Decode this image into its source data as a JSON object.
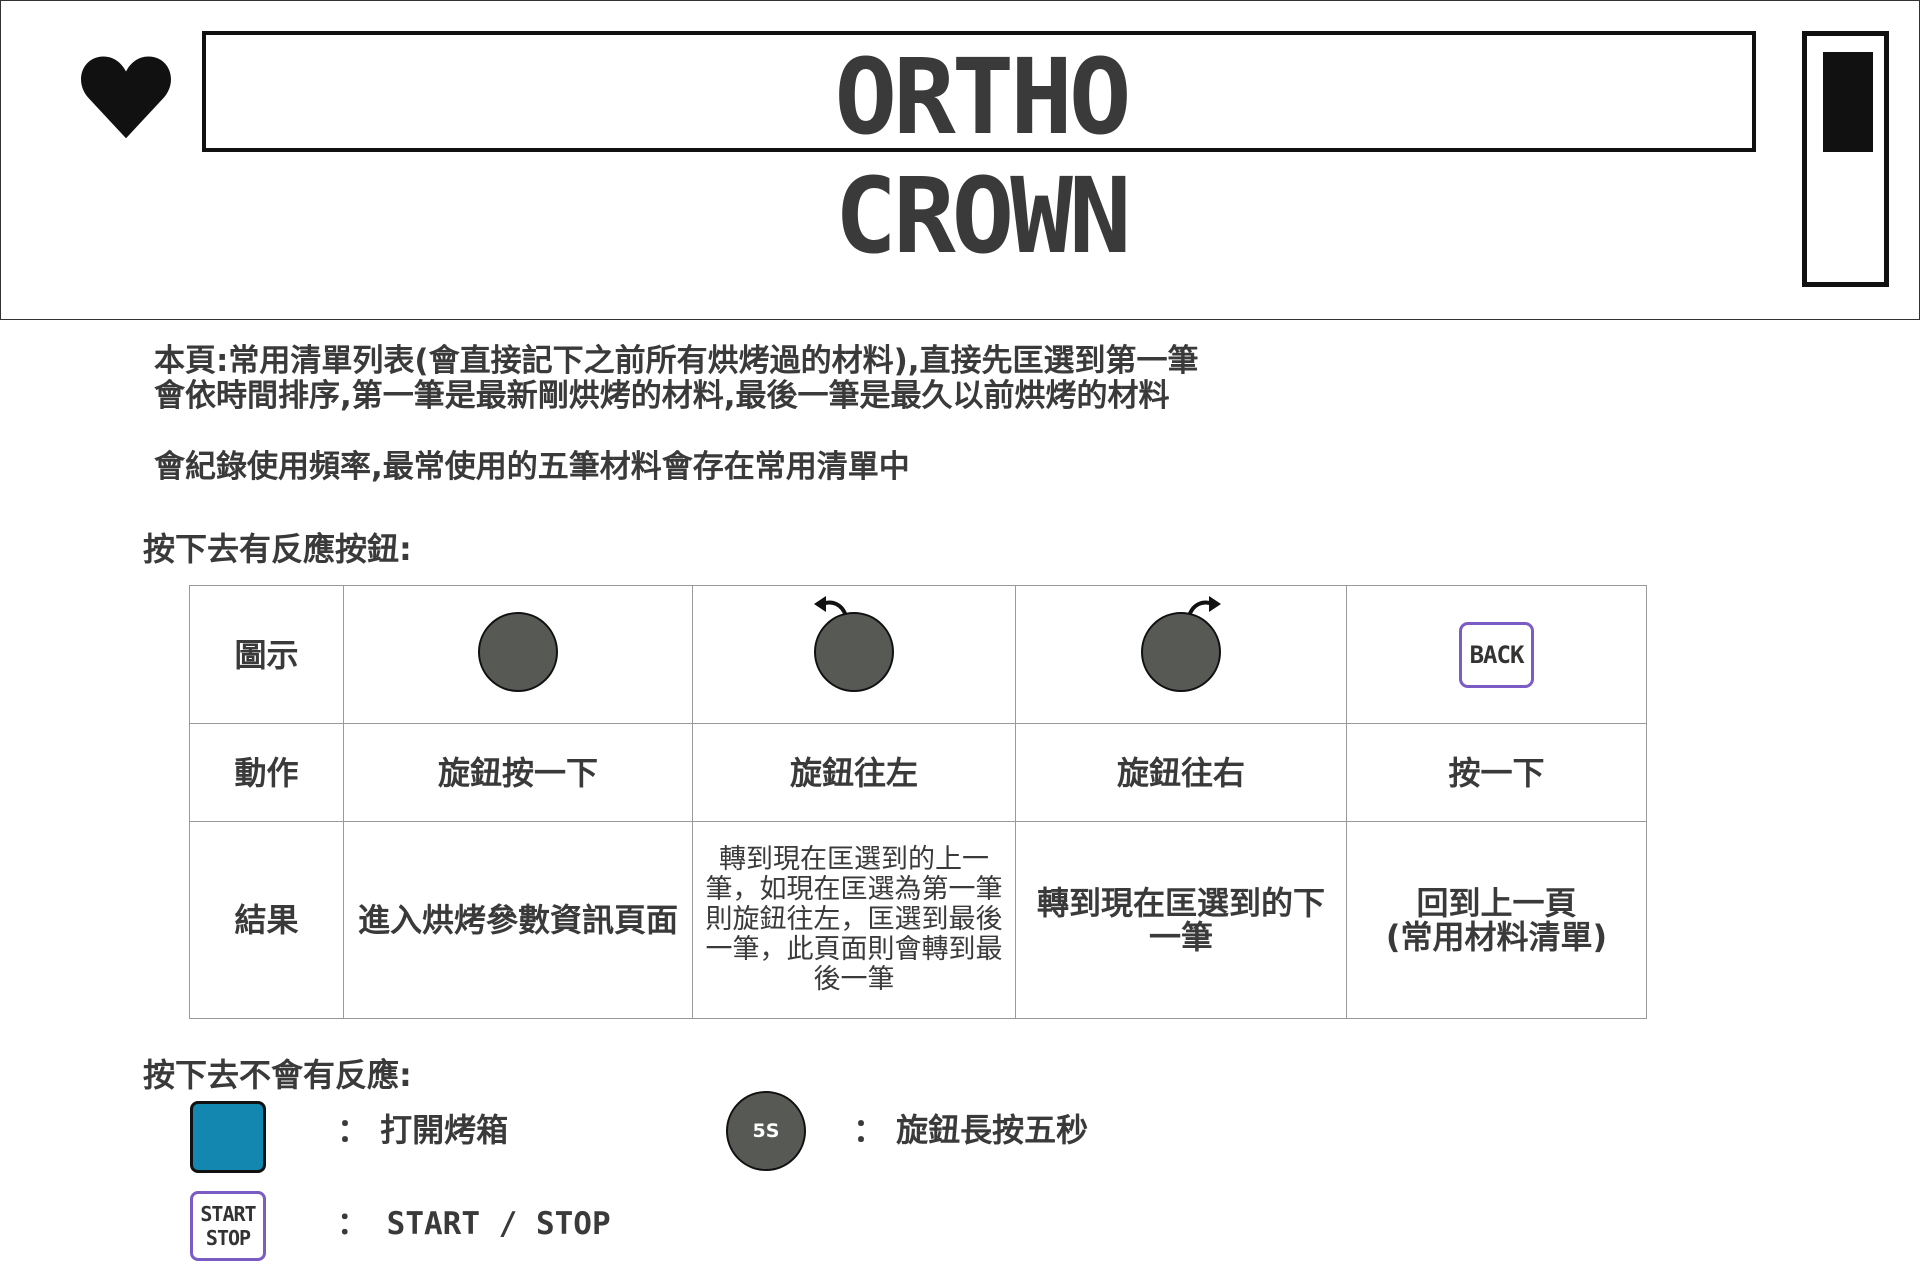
{
  "screen": {
    "title_line1": "ORTHO",
    "title_line2": "CROWN",
    "favorite_icon": "heart-icon",
    "scroll_position": 0.0
  },
  "description": {
    "line1": "本頁:常用清單列表(會直接記下之前所有烘烤過的材料),直接先匡選到第一筆",
    "line2": "會依時間排序,第一筆是最新剛烘烤的材料,最後一筆是最久以前烘烤的材料",
    "line3": "會紀錄使用頻率,最常使用的五筆材料會存在常用清單中"
  },
  "reactive_section": {
    "title": "按下去有反應按鈕:",
    "row_labels": {
      "icon": "圖示",
      "action": "動作",
      "result": "結果"
    },
    "columns": [
      {
        "icon": "knob-press-icon",
        "action": "旋鈕按一下",
        "result": "進入烘烤參數資訊頁面"
      },
      {
        "icon": "knob-rotate-left-icon",
        "action": "旋鈕往左",
        "result": "轉到現在匡選到的上一筆，如現在匡選為第一筆則旋鈕往左，匡選到最後一筆，此頁面則會轉到最後一筆"
      },
      {
        "icon": "knob-rotate-right-icon",
        "action": "旋鈕往右",
        "result": "轉到現在匡選到的下一筆"
      },
      {
        "icon": "back-button-icon",
        "icon_label": "BACK",
        "action": "按一下",
        "result_line1": "回到上一頁",
        "result_line2": "(常用材料清單)"
      }
    ]
  },
  "non_reactive_section": {
    "title": "按下去不會有反應:",
    "items": [
      {
        "icon": "oven-button-icon",
        "label": "： 打開烤箱"
      },
      {
        "icon": "knob-5s-icon",
        "icon_label": "5S",
        "label": "： 旋鈕長按五秒"
      },
      {
        "icon": "start-stop-button-icon",
        "icon_label_line1": "START",
        "icon_label_line2": "STOP",
        "label": "： START / STOP"
      }
    ]
  },
  "colors": {
    "knob": "#575955",
    "oven_button": "#1487b1",
    "button_outline": "#7b5cc4",
    "text": "#3a3a3a"
  }
}
